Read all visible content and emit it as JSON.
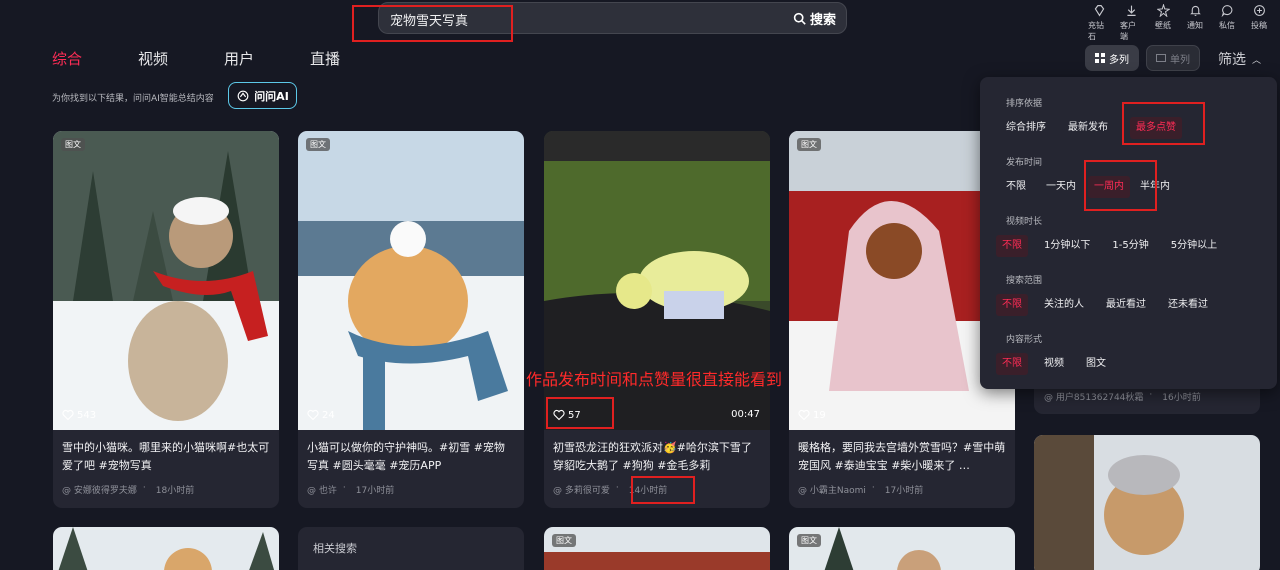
{
  "search": {
    "query": "宠物雪天写真",
    "button_label": "搜索"
  },
  "top_icons": [
    {
      "label": "充钻石",
      "icon": "diamond-icon"
    },
    {
      "label": "客户端",
      "icon": "download-icon"
    },
    {
      "label": "壁纸",
      "icon": "wallpaper-icon"
    },
    {
      "label": "通知",
      "icon": "bell-icon"
    },
    {
      "label": "私信",
      "icon": "message-icon"
    },
    {
      "label": "投稿",
      "icon": "upload-icon"
    }
  ],
  "tabs": [
    {
      "label": "综合",
      "active": true
    },
    {
      "label": "视频",
      "active": false
    },
    {
      "label": "用户",
      "active": false
    },
    {
      "label": "直播",
      "active": false
    }
  ],
  "view": {
    "multi_label": "多列",
    "single_label": "单列",
    "filter_label": "筛选"
  },
  "hint": {
    "text": "为你找到以下结果，问问AI智能总结内容",
    "ai_button": "问问AI"
  },
  "cards": [
    {
      "badge": "图文",
      "likes": "543",
      "duration": "",
      "title": "雪中的小猫咪。哪里来的小猫咪啊#也太可爱了吧 #宠物写真",
      "author": "@ 安娜彼得罗夫娜",
      "time": "18小时前"
    },
    {
      "badge": "图文",
      "likes": "24",
      "duration": "",
      "title": "小猫可以做你的守护神吗。#初雪 #宠物写真 #圆头毫毫 #宠历APP",
      "author": "@ 也许",
      "time": "17小时前"
    },
    {
      "badge": "",
      "likes": "57",
      "duration": "00:47",
      "title": "初雪恐龙汪的狂欢派对🥳#哈尔滨下雪了穿貂吃大鹅了 #狗狗 #金毛多莉",
      "author": "@ 多莉很可爱",
      "time": "14小时前"
    },
    {
      "badge": "图文",
      "likes": "19",
      "duration": "",
      "title": "暖格格，要同我去宫墙外赏雪吗？#雪中萌宠国风 #泰迪宝宝 #柴小暖来了 …",
      "author": "@ 小霸主Naomi",
      "time": "17小时前"
    }
  ],
  "right_card_meta": {
    "author": "@ 用户851362744秋霜",
    "time": "16小时前"
  },
  "bottom": {
    "related_label": "相关搜索",
    "badges": [
      "图文",
      "图文"
    ]
  },
  "filter_panel": {
    "groups": [
      {
        "title": "排序依据",
        "options": [
          "综合排序",
          "最新发布",
          "最多点赞"
        ],
        "selected": 2
      },
      {
        "title": "发布时间",
        "options": [
          "不限",
          "一天内",
          "一周内",
          "半年内"
        ],
        "selected": 2
      },
      {
        "title": "视频时长",
        "options": [
          "不限",
          "1分钟以下",
          "1-5分钟",
          "5分钟以上"
        ],
        "selected": 0
      },
      {
        "title": "搜索范围",
        "options": [
          "不限",
          "关注的人",
          "最近看过",
          "还未看过"
        ],
        "selected": 0
      },
      {
        "title": "内容形式",
        "options": [
          "不限",
          "视频",
          "图文"
        ],
        "selected": 0
      }
    ]
  },
  "annotation": {
    "text": "作品发布时间和点赞量很直接能看到",
    "color": "#ff2a2a"
  },
  "colors": {
    "accent": "#fe2c55",
    "background": "#161823",
    "card": "#252632",
    "annotation_box": "#e02020"
  }
}
